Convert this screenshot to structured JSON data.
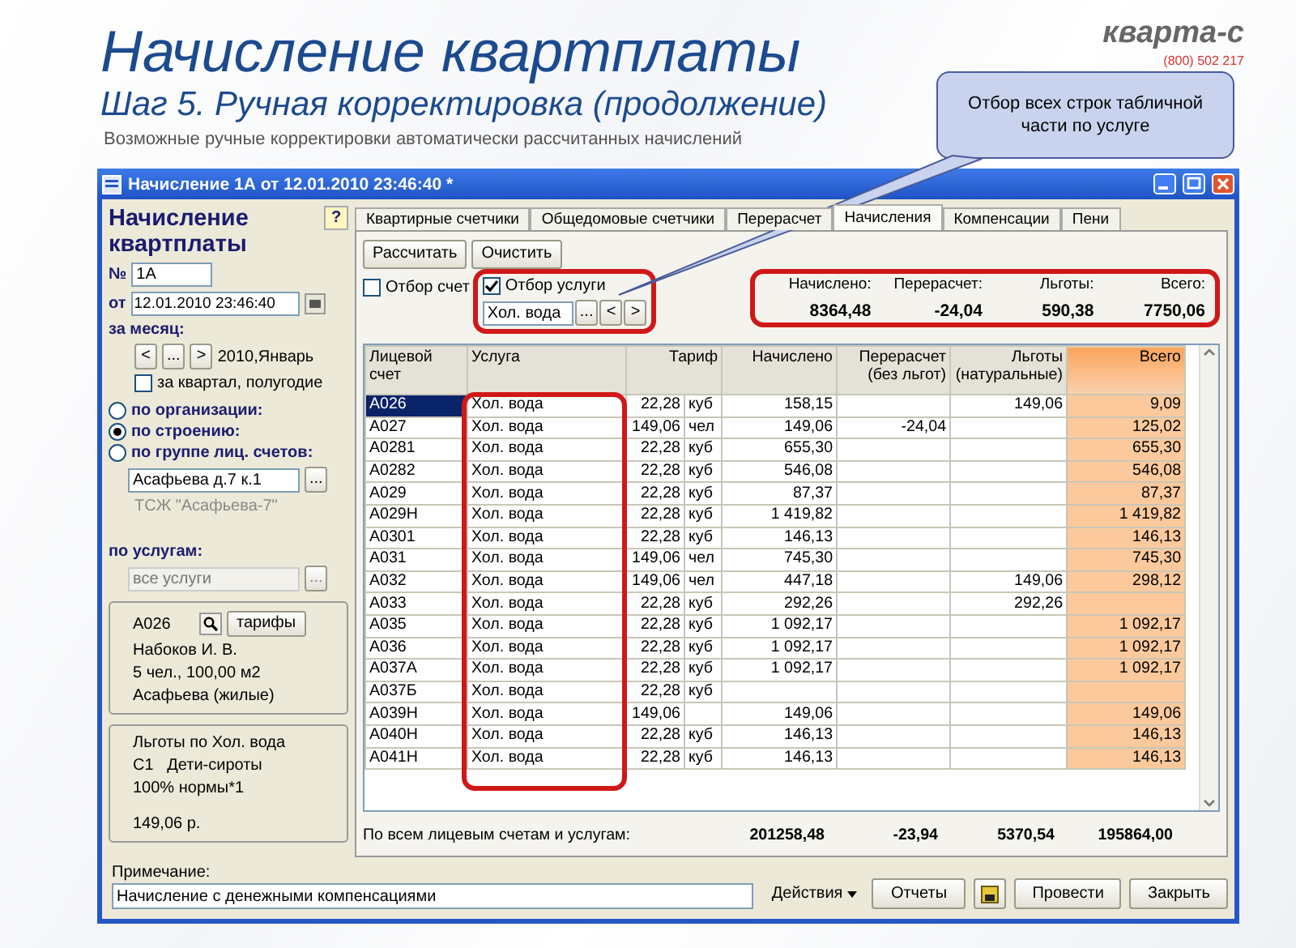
{
  "slide": {
    "title": "Начисление квартплаты",
    "subtitle": "Шаг 5.  Ручная корректировка (продолжение)",
    "description": "Возможные ручные корректировки автоматически рассчитанных начислений",
    "logo": "кварта-с",
    "phone": "(800) 502 217",
    "callout": "Отбор всех строк табличной части по услуге"
  },
  "window": {
    "title": "Начисление 1А от 12.01.2010 23:46:40 *"
  },
  "left_panel": {
    "heading": "Начисление квартплаты",
    "help": "?",
    "number_label": "№",
    "number": "1А",
    "date_label": "от",
    "date": "12.01.2010 23:46:40",
    "month_label": "за месяц:",
    "month_nav": [
      "<",
      "...",
      ">"
    ],
    "month": "2010,Январь",
    "quarter": {
      "label": "за квартал, полугодие",
      "checked": false
    },
    "scope": [
      {
        "label": "по организации:",
        "selected": false
      },
      {
        "label": "по строению:",
        "selected": true
      },
      {
        "label": "по группе лиц. счетов:",
        "selected": false
      }
    ],
    "building": "Асафьева д.7 к.1",
    "building_button": "...",
    "hoa": "ТСЖ \"Асафьева-7\"",
    "services_label": "по услугам:",
    "services": {
      "placeholder": "все услуги",
      "button": "...",
      "disabled": true
    },
    "account": {
      "id": "А026",
      "tariffs_button": "тарифы",
      "lines": [
        "Набоков И. В.",
        "5 чел., 100,00 м2",
        "Асафьева (жилые)"
      ]
    },
    "benefit": {
      "lines": [
        "Льготы по Хол. вода",
        "С1   Дети-сироты",
        "100% нормы*1"
      ],
      "amount": "149,06 р."
    }
  },
  "tabs": [
    {
      "label": "Квартирные счетчики",
      "selected": false
    },
    {
      "label": "Общедомовые счетчики",
      "selected": false
    },
    {
      "label": "Перерасчет",
      "selected": false
    },
    {
      "label": "Начисления",
      "selected": true
    },
    {
      "label": "Компенсации",
      "selected": false
    },
    {
      "label": "Пени",
      "selected": false
    }
  ],
  "toolbar": [
    "Рассчитать",
    "Очистить"
  ],
  "filters": {
    "account": {
      "label": "Отбор счет",
      "checked": false
    },
    "service": {
      "label": "Отбор услуги",
      "checked": true
    },
    "service_value": "Хол. вода",
    "buttons": [
      "...",
      "<",
      ">"
    ]
  },
  "summary": [
    {
      "label": "Начислено:",
      "value": "8364,48"
    },
    {
      "label": "Перерасчет:",
      "value": "-24,04"
    },
    {
      "label": "Льготы:",
      "value": "590,38"
    },
    {
      "label": "Всего:",
      "value": "7750,06"
    }
  ],
  "table": {
    "columns": [
      "Лицевой счет",
      "Услуга",
      "Тариф",
      "Начислено",
      "Перерасчет\n(без льгот)",
      "Льготы\n(натуральные)",
      "Всего"
    ],
    "rows": [
      {
        "account": "А026",
        "service": "Хол. вода",
        "tariff": "22,28",
        "unit": "куб",
        "charged": "158,15",
        "recalc": "",
        "benefits": "149,06",
        "total": "9,09",
        "selected": true
      },
      {
        "account": "А027",
        "service": "Хол. вода",
        "tariff": "149,06",
        "unit": "чел",
        "charged": "149,06",
        "recalc": "-24,04",
        "benefits": "",
        "total": "125,02",
        "selected": false
      },
      {
        "account": "А0281",
        "service": "Хол. вода",
        "tariff": "22,28",
        "unit": "куб",
        "charged": "655,30",
        "recalc": "",
        "benefits": "",
        "total": "655,30",
        "selected": false
      },
      {
        "account": "А0282",
        "service": "Хол. вода",
        "tariff": "22,28",
        "unit": "куб",
        "charged": "546,08",
        "recalc": "",
        "benefits": "",
        "total": "546,08",
        "selected": false
      },
      {
        "account": "А029",
        "service": "Хол. вода",
        "tariff": "22,28",
        "unit": "куб",
        "charged": "87,37",
        "recalc": "",
        "benefits": "",
        "total": "87,37",
        "selected": false
      },
      {
        "account": "А029Н",
        "service": "Хол. вода",
        "tariff": "22,28",
        "unit": "куб",
        "charged": "1 419,82",
        "recalc": "",
        "benefits": "",
        "total": "1 419,82",
        "selected": false
      },
      {
        "account": "А0301",
        "service": "Хол. вода",
        "tariff": "22,28",
        "unit": "куб",
        "charged": "146,13",
        "recalc": "",
        "benefits": "",
        "total": "146,13",
        "selected": false
      },
      {
        "account": "А031",
        "service": "Хол. вода",
        "tariff": "149,06",
        "unit": "чел",
        "charged": "745,30",
        "recalc": "",
        "benefits": "",
        "total": "745,30",
        "selected": false
      },
      {
        "account": "А032",
        "service": "Хол. вода",
        "tariff": "149,06",
        "unit": "чел",
        "charged": "447,18",
        "recalc": "",
        "benefits": "149,06",
        "total": "298,12",
        "selected": false
      },
      {
        "account": "А033",
        "service": "Хол. вода",
        "tariff": "22,28",
        "unit": "куб",
        "charged": "292,26",
        "recalc": "",
        "benefits": "292,26",
        "total": "",
        "selected": false
      },
      {
        "account": "А035",
        "service": "Хол. вода",
        "tariff": "22,28",
        "unit": "куб",
        "charged": "1 092,17",
        "recalc": "",
        "benefits": "",
        "total": "1 092,17",
        "selected": false
      },
      {
        "account": "А036",
        "service": "Хол. вода",
        "tariff": "22,28",
        "unit": "куб",
        "charged": "1 092,17",
        "recalc": "",
        "benefits": "",
        "total": "1 092,17",
        "selected": false
      },
      {
        "account": "А037А",
        "service": "Хол. вода",
        "tariff": "22,28",
        "unit": "куб",
        "charged": "1 092,17",
        "recalc": "",
        "benefits": "",
        "total": "1 092,17",
        "selected": false
      },
      {
        "account": "А037Б",
        "service": "Хол. вода",
        "tariff": "22,28",
        "unit": "куб",
        "charged": "",
        "recalc": "",
        "benefits": "",
        "total": "",
        "selected": false
      },
      {
        "account": "А039Н",
        "service": "Хол. вода",
        "tariff": "149,06",
        "unit": "",
        "charged": "149,06",
        "recalc": "",
        "benefits": "",
        "total": "149,06",
        "selected": false
      },
      {
        "account": "А040Н",
        "service": "Хол. вода",
        "tariff": "22,28",
        "unit": "куб",
        "charged": "146,13",
        "recalc": "",
        "benefits": "",
        "total": "146,13",
        "selected": false
      },
      {
        "account": "А041Н",
        "service": "Хол. вода",
        "tariff": "22,28",
        "unit": "куб",
        "charged": "146,13",
        "recalc": "",
        "benefits": "",
        "total": "146,13",
        "selected": false
      }
    ],
    "totals": {
      "label": "По всем лицевым счетам и услугам:",
      "charged": "201258,48",
      "recalc": "-23,94",
      "benefits": "5370,54",
      "total": "195864,00"
    }
  },
  "note": {
    "label": "Примечание:",
    "value": "Начисление с денежными компенсациями"
  },
  "actions": {
    "menu": "Действия",
    "buttons": [
      "Отчеты",
      "Провести",
      "Закрыть"
    ]
  }
}
